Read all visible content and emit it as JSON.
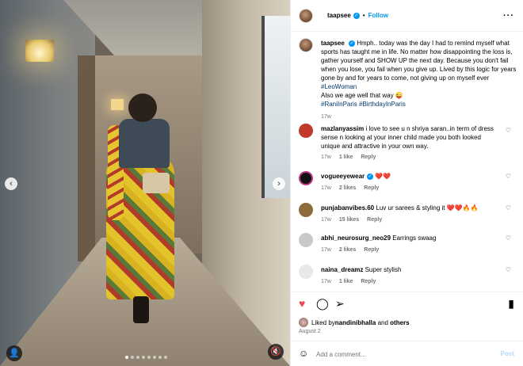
{
  "media": {
    "total_dots": 8,
    "active_dot": 0,
    "prev_glyph": "‹",
    "next_glyph": "›",
    "tag_glyph": "👤",
    "mute_glyph": "🔇"
  },
  "header": {
    "username": "taapsee",
    "verified_glyph": "✓",
    "separator": "•",
    "follow_label": "Follow",
    "more_glyph": "···"
  },
  "caption": {
    "username": "taapsee",
    "text": "Hmph.. today was the day I had to remind myself what sports has taught me in life. No matter how disappointing the loss is, gather yourself and SHOW UP the next day. Because you don't fail when you lose, you fail when you give up. Lived by this logic for years gone by and for years to come, not giving up on myself ever ",
    "hashtag_inline": "#LeoWoman",
    "line2": "Also we age well that way 😜",
    "hashtags": "#RaniInParis #BirthdayInParis",
    "time": "17w"
  },
  "comments": [
    {
      "username": "mazlanyassim",
      "text": "i love to see u n shriya saran..in term of dress sense n looking at your inner child made you both looked unique and attractive in your own way.",
      "time": "17w",
      "likes": "1 like",
      "reply": "Reply",
      "avatar_color": "#c0392b"
    },
    {
      "username": "vogueeyewear",
      "verified": true,
      "text": "❤️❤️",
      "time": "17w",
      "likes": "2 likes",
      "reply": "Reply",
      "avatar_color": "#111111"
    },
    {
      "username": "punjabanvibes.60",
      "text": "Luv ur sarees & styling it ❤️❤️🔥🔥",
      "time": "17w",
      "likes": "15 likes",
      "reply": "Reply",
      "avatar_color": "#8b6b3a"
    },
    {
      "username": "abhi_neurosurg_neo29",
      "text": "Earrings swaag",
      "time": "17w",
      "likes": "2 likes",
      "reply": "Reply",
      "avatar_color": "#c8c8c8"
    },
    {
      "username": "naina_dreamz",
      "text": "Super stylish",
      "time": "17w",
      "likes": "1 like",
      "reply": "Reply",
      "avatar_color": "#e8e8e8"
    }
  ],
  "actions": {
    "like_glyph": "♥",
    "comment_glyph": "◯",
    "share_glyph": "➢",
    "save_glyph": "▮",
    "liked_by_prefix": "Liked by ",
    "liked_by_user": "nandinibhalla",
    "liked_by_mid": " and ",
    "liked_by_others": "others",
    "date": "August 2"
  },
  "add_comment": {
    "emoji_glyph": "☺",
    "placeholder": "Add a comment...",
    "post_label": "Post"
  },
  "comment_heart_glyph": "♡"
}
